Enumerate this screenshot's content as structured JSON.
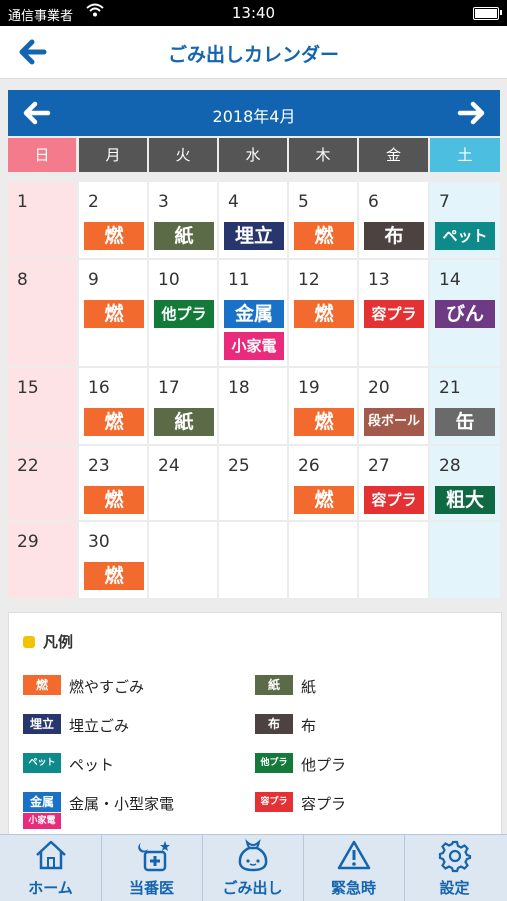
{
  "status": {
    "carrier": "通信事業者",
    "time": "13:40",
    "wifi_icon": "wifi-icon",
    "battery_icon": "battery-icon"
  },
  "nav": {
    "title": "ごみ出しカレンダー",
    "back_icon": "back-arrow-icon"
  },
  "calendar": {
    "month_label": "2018年4月",
    "weekdays": [
      "日",
      "月",
      "火",
      "水",
      "木",
      "金",
      "土"
    ],
    "weekday_colors": [
      "#f47b8c",
      "#555555",
      "#555555",
      "#555555",
      "#555555",
      "#555555",
      "#4cbfe0"
    ],
    "weeks": [
      [
        {
          "day": "1",
          "items": []
        },
        {
          "day": "2",
          "items": [
            "moeru"
          ]
        },
        {
          "day": "3",
          "items": [
            "kami"
          ]
        },
        {
          "day": "4",
          "items": [
            "umetate"
          ]
        },
        {
          "day": "5",
          "items": [
            "moeru"
          ]
        },
        {
          "day": "6",
          "items": [
            "nuno"
          ]
        },
        {
          "day": "7",
          "items": [
            "pet"
          ]
        }
      ],
      [
        {
          "day": "8",
          "items": []
        },
        {
          "day": "9",
          "items": [
            "moeru"
          ]
        },
        {
          "day": "10",
          "items": [
            "tapura"
          ]
        },
        {
          "day": "11",
          "items": [
            "kinzoku",
            "kokaden"
          ]
        },
        {
          "day": "12",
          "items": [
            "moeru"
          ]
        },
        {
          "day": "13",
          "items": [
            "yopura"
          ]
        },
        {
          "day": "14",
          "items": [
            "bin"
          ]
        }
      ],
      [
        {
          "day": "15",
          "items": []
        },
        {
          "day": "16",
          "items": [
            "moeru"
          ]
        },
        {
          "day": "17",
          "items": [
            "kami"
          ]
        },
        {
          "day": "18",
          "items": []
        },
        {
          "day": "19",
          "items": [
            "moeru"
          ]
        },
        {
          "day": "20",
          "items": [
            "danboru"
          ]
        },
        {
          "day": "21",
          "items": [
            "kan"
          ]
        }
      ],
      [
        {
          "day": "22",
          "items": []
        },
        {
          "day": "23",
          "items": [
            "moeru"
          ]
        },
        {
          "day": "24",
          "items": []
        },
        {
          "day": "25",
          "items": []
        },
        {
          "day": "26",
          "items": [
            "moeru"
          ]
        },
        {
          "day": "27",
          "items": [
            "yopura"
          ]
        },
        {
          "day": "28",
          "items": [
            "sodai"
          ]
        }
      ],
      [
        {
          "day": "29",
          "items": []
        },
        {
          "day": "30",
          "items": [
            "moeru"
          ]
        },
        {
          "day": "",
          "items": []
        },
        {
          "day": "",
          "items": []
        },
        {
          "day": "",
          "items": []
        },
        {
          "day": "",
          "items": []
        },
        {
          "day": "",
          "items": []
        }
      ]
    ]
  },
  "garbage_types": {
    "moeru": {
      "label": "燃",
      "color": "#f26a2e"
    },
    "kami": {
      "label": "紙",
      "color": "#5b6b48"
    },
    "umetate": {
      "label": "埋立",
      "color": "#28366e"
    },
    "nuno": {
      "label": "布",
      "color": "#4c4340"
    },
    "pet": {
      "label": "ペット",
      "color": "#0f8a8a"
    },
    "tapura": {
      "label": "他プラ",
      "color": "#137a3a"
    },
    "kinzoku": {
      "label": "金属",
      "color": "#1a72c8"
    },
    "kokaden": {
      "label": "小家電",
      "color": "#ea2a7a"
    },
    "yopura": {
      "label": "容プラ",
      "color": "#e43234"
    },
    "bin": {
      "label": "びん",
      "color": "#6e3a84"
    },
    "danboru": {
      "label": "段ボール",
      "color": "#a45a4a"
    },
    "kan": {
      "label": "缶",
      "color": "#6a6a6a"
    },
    "sodai": {
      "label": "粗大",
      "color": "#0f6a44"
    }
  },
  "legend": {
    "title": "凡例",
    "items": [
      {
        "badge": "燃",
        "text": "燃やすごみ",
        "color": "#f26a2e"
      },
      {
        "badge": "紙",
        "text": "紙",
        "color": "#5b6b48"
      },
      {
        "badge": "埋立",
        "text": "埋立ごみ",
        "color": "#28366e"
      },
      {
        "badge": "布",
        "text": "布",
        "color": "#4c4340"
      },
      {
        "badge": "ペット",
        "text": "ペット",
        "color": "#0f8a8a"
      },
      {
        "badge": "他プラ",
        "text": "他プラ",
        "color": "#137a3a"
      },
      {
        "badge": "金属",
        "badge2": "小家電",
        "text": "金属・小型家電",
        "color": "#1a72c8",
        "color2": "#ea2a7a"
      },
      {
        "badge": "容プラ",
        "text": "容プラ",
        "color": "#e43234"
      }
    ]
  },
  "tabs": [
    {
      "label": "ホーム",
      "icon": "home-icon"
    },
    {
      "label": "当番医",
      "icon": "night-doctor-icon"
    },
    {
      "label": "ごみ出し",
      "icon": "garbage-bag-icon"
    },
    {
      "label": "緊急時",
      "icon": "warning-icon"
    },
    {
      "label": "設定",
      "icon": "gear-icon"
    }
  ]
}
